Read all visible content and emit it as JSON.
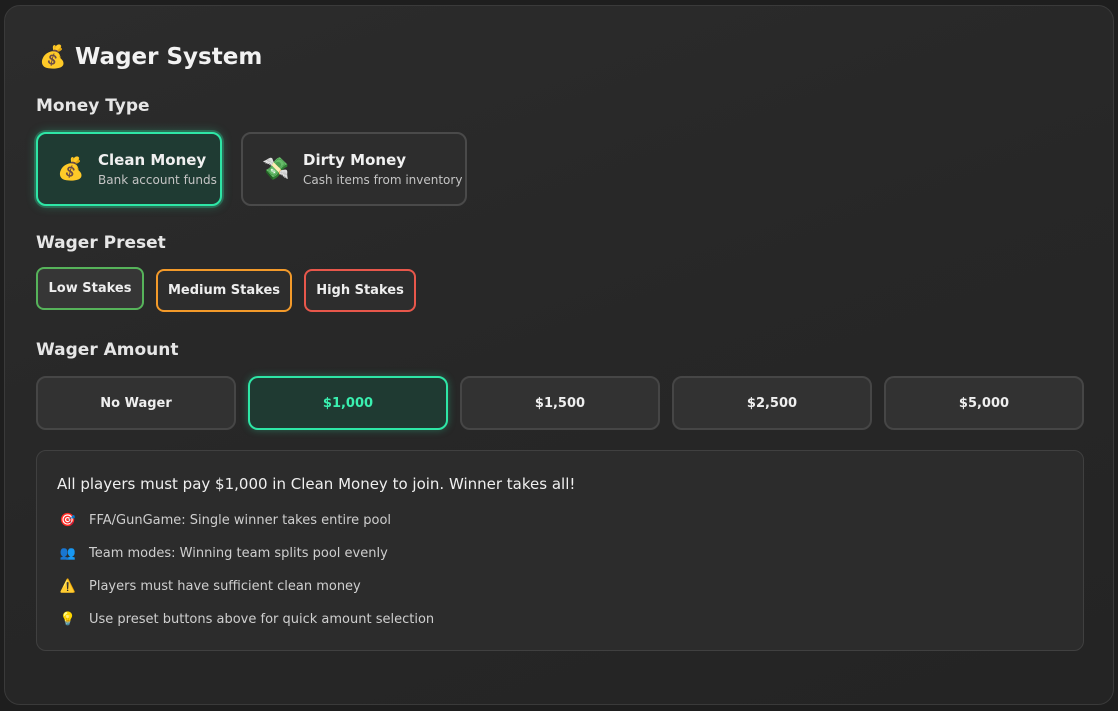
{
  "header": {
    "icon": "money-bag-icon",
    "title": "Wager System"
  },
  "money_type": {
    "label": "Money Type",
    "options": [
      {
        "icon": "money-bag-icon",
        "glyph": "💰",
        "name": "Clean Money",
        "desc": "Bank account funds",
        "selected": true
      },
      {
        "icon": "flying-money-icon",
        "glyph": "💸",
        "name": "Dirty Money",
        "desc": "Cash items from inventory",
        "selected": false
      }
    ]
  },
  "wager_preset": {
    "label": "Wager Preset",
    "options": [
      {
        "label": "Low Stakes",
        "color": "#56b35a",
        "selected": true
      },
      {
        "label": "Medium Stakes",
        "color": "#f39a2a",
        "selected": false
      },
      {
        "label": "High Stakes",
        "color": "#e8574b",
        "selected": false
      }
    ]
  },
  "wager_amount": {
    "label": "Wager Amount",
    "options": [
      "No Wager",
      "$1,000",
      "$1,500",
      "$2,500",
      "$5,000"
    ],
    "selected": "$1,000"
  },
  "info": {
    "main": "All players must pay $1,000 in Clean Money to join. Winner takes all!",
    "items": [
      {
        "icon": "target-icon",
        "glyph": "🎯",
        "text": "FFA/GunGame: Single winner takes entire pool"
      },
      {
        "icon": "team-icon",
        "glyph": "👥",
        "text": "Team modes: Winning team splits pool evenly"
      },
      {
        "icon": "warning-icon",
        "glyph": "⚠️",
        "text": "Players must have sufficient clean money"
      },
      {
        "icon": "lightbulb-icon",
        "glyph": "💡",
        "text": "Use preset buttons above for quick amount selection"
      }
    ]
  },
  "colors": {
    "accent": "#2ee6a6",
    "panel_bg": "#2a2a2a"
  }
}
